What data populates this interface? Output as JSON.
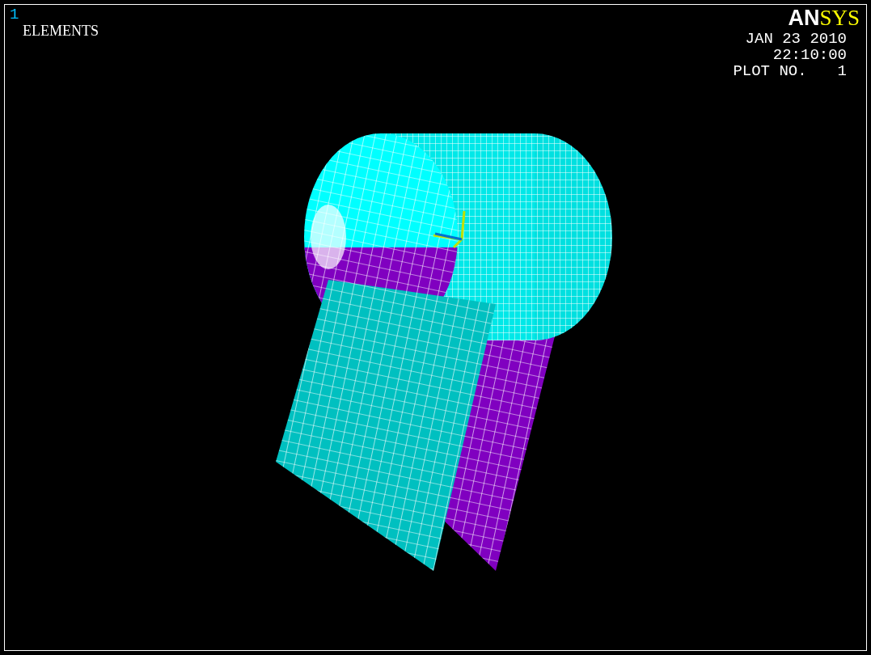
{
  "viewport": {
    "window_number": "1",
    "plot_label": "ELEMENTS",
    "logo_parts": [
      {
        "text": "AN",
        "color": "#ffffff"
      },
      {
        "text": "SYS",
        "color": "#ffff00"
      }
    ],
    "date": "JAN 23 2010",
    "time": "22:10:00",
    "plot_number_label": "PLOT NO.",
    "plot_number": "1"
  }
}
